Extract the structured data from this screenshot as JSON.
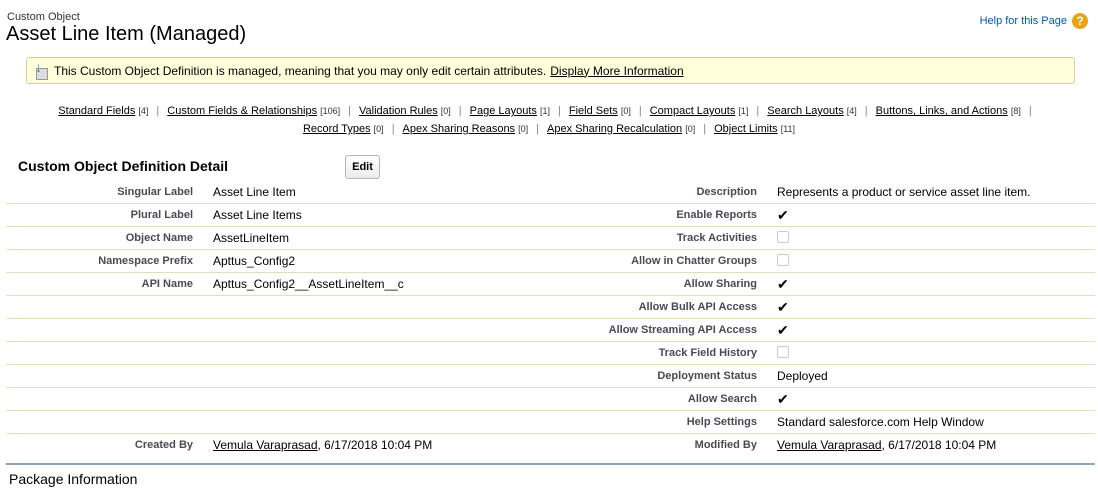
{
  "header": {
    "breadcrumb": "Custom Object",
    "title": "Asset Line Item (Managed)",
    "help_link": "Help for this Page"
  },
  "message": {
    "text": "This Custom Object Definition is managed, meaning that you may only edit certain attributes.",
    "link": "Display More Information"
  },
  "related_links": [
    {
      "label": "Standard Fields",
      "count": "[4]"
    },
    {
      "label": "Custom Fields & Relationships",
      "count": "[106]"
    },
    {
      "label": "Validation Rules",
      "count": "[0]"
    },
    {
      "label": "Page Layouts",
      "count": "[1]"
    },
    {
      "label": "Field Sets",
      "count": "[0]"
    },
    {
      "label": "Compact Layouts",
      "count": "[1]"
    },
    {
      "label": "Search Layouts",
      "count": "[4]"
    },
    {
      "label": "Buttons, Links, and Actions",
      "count": "[8]"
    },
    {
      "label": "Record Types",
      "count": "[0]"
    },
    {
      "label": "Apex Sharing Reasons",
      "count": "[0]"
    },
    {
      "label": "Apex Sharing Recalculation",
      "count": "[0]"
    },
    {
      "label": "Object Limits",
      "count": "[11]"
    }
  ],
  "detail": {
    "title": "Custom Object Definition Detail",
    "edit_label": "Edit",
    "rows": [
      {
        "l1": "Singular Label",
        "v1": "Asset Line Item",
        "l2": "Description",
        "v2": "Represents a product or service asset line item."
      },
      {
        "l1": "Plural Label",
        "v1": "Asset Line Items",
        "l2": "Enable Reports",
        "c2": true
      },
      {
        "l1": "Object Name",
        "v1": "AssetLineItem",
        "l2": "Track Activities",
        "c2": false
      },
      {
        "l1": "Namespace Prefix",
        "v1": "Apttus_Config2",
        "l2": "Allow in Chatter Groups",
        "c2": false
      },
      {
        "l1": "API Name",
        "v1": "Apttus_Config2__AssetLineItem__c",
        "l2": "Allow Sharing",
        "c2": true
      },
      {
        "l2": "Allow Bulk API Access",
        "c2": true
      },
      {
        "l2": "Allow Streaming API Access",
        "c2": true
      },
      {
        "l2": "Track Field History",
        "c2": false
      },
      {
        "l2": "Deployment Status",
        "v2": "Deployed"
      },
      {
        "l2": "Allow Search",
        "c2": true
      },
      {
        "l2": "Help Settings",
        "v2": "Standard salesforce.com Help Window"
      }
    ],
    "created_by": {
      "label": "Created By",
      "user": "Vemula Varaprasad",
      "date": ", 6/17/2018 10:04 PM"
    },
    "modified_by": {
      "label": "Modified By",
      "user": "Vemula Varaprasad",
      "date": ", 6/17/2018 10:04 PM"
    }
  },
  "package": {
    "title": "Package Information"
  }
}
